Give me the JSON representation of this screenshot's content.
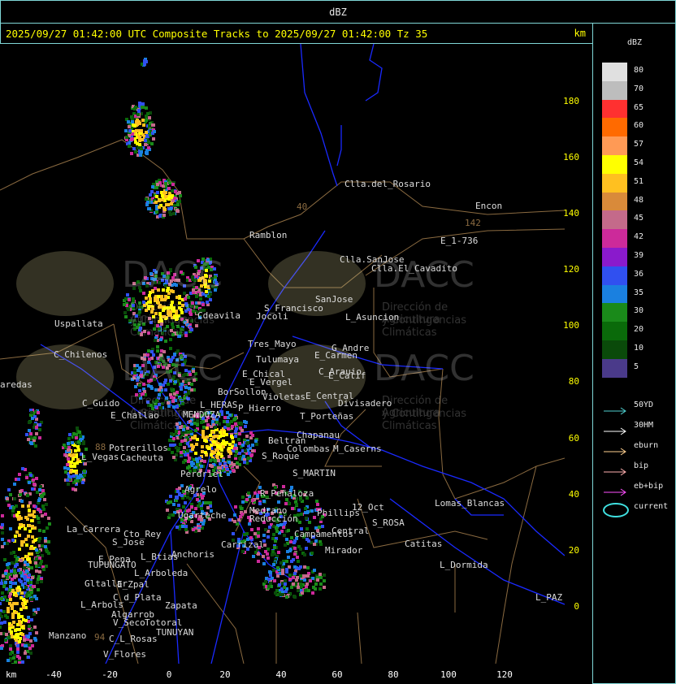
{
  "header": {
    "title": "dBZ"
  },
  "title_bar": {
    "text": "2025/09/27 01:42:00 UTC Composite Tracks to 2025/09/27 01:42:00 Tz 35",
    "unit": "km"
  },
  "axes": {
    "y_ticks": [
      "180",
      "160",
      "140",
      "120",
      "100",
      "80",
      "60",
      "40",
      "20",
      "0"
    ],
    "x_ticks": [
      "-40",
      "-20",
      "0",
      "20",
      "40",
      "60",
      "80",
      "100",
      "120"
    ],
    "x_unit": "km"
  },
  "legend": {
    "title": "dBZ",
    "scale": [
      {
        "label": "80",
        "color": "#e0e0e0"
      },
      {
        "label": "70",
        "color": "#bdbdbd"
      },
      {
        "label": "65",
        "color": "#ff3030"
      },
      {
        "label": "60",
        "color": "#ff6a00"
      },
      {
        "label": "57",
        "color": "#ff9a55"
      },
      {
        "label": "54",
        "color": "#ffff00"
      },
      {
        "label": "51",
        "color": "#ffc020"
      },
      {
        "label": "48",
        "color": "#d98a3a"
      },
      {
        "label": "45",
        "color": "#c46a8a"
      },
      {
        "label": "42",
        "color": "#cc2a9a"
      },
      {
        "label": "39",
        "color": "#8a1acc"
      },
      {
        "label": "36",
        "color": "#3050f0"
      },
      {
        "label": "35",
        "color": "#1a80e0"
      },
      {
        "label": "30",
        "color": "#1a8a1a"
      },
      {
        "label": "20",
        "color": "#0a6a0a"
      },
      {
        "label": "10",
        "color": "#0a4a0a"
      },
      {
        "label": "5",
        "color": "#4a3a8a"
      }
    ],
    "tracks": [
      {
        "label": "50YD",
        "color": "#4fd0d0"
      },
      {
        "label": "30HM",
        "color": "#ffffff"
      },
      {
        "label": "eburn",
        "color": "#ffd090"
      },
      {
        "label": "bip",
        "color": "#ffb0b0"
      },
      {
        "label": "eb+bip",
        "color": "#ff50ff"
      },
      {
        "label": "current",
        "color": "#40e0e0"
      }
    ]
  },
  "places": [
    {
      "name": "Clla.del_Rosario"
    },
    {
      "name": "Encon"
    },
    {
      "name": "142"
    },
    {
      "name": "E_1-736"
    },
    {
      "name": "Ramblon"
    },
    {
      "name": "Clla.SanJose"
    },
    {
      "name": "Clla.El_Cavadito"
    },
    {
      "name": "Uspallata"
    },
    {
      "name": "Cdeavila"
    },
    {
      "name": "S_Francisco"
    },
    {
      "name": "Jocoli"
    },
    {
      "name": "SanJose"
    },
    {
      "name": "L_Asuncion"
    },
    {
      "name": "C_Chilenos"
    },
    {
      "name": "Tres_Mayo"
    },
    {
      "name": "Tulumaya"
    },
    {
      "name": "G_Andre"
    },
    {
      "name": "E_Carmen"
    },
    {
      "name": "aredas"
    },
    {
      "name": "E_Chical"
    },
    {
      "name": "E_Vergel"
    },
    {
      "name": "C_Arauio"
    },
    {
      "name": "E_Calif"
    },
    {
      "name": "BorSollon"
    },
    {
      "name": "Violetas"
    },
    {
      "name": "E_Central"
    },
    {
      "name": "Divisadero"
    },
    {
      "name": "C_Guido"
    },
    {
      "name": "E_Challao"
    },
    {
      "name": "P_Hierro"
    },
    {
      "name": "T_Porteñas"
    },
    {
      "name": "Chapanau"
    },
    {
      "name": "Beltran"
    },
    {
      "name": "Potrerillos"
    },
    {
      "name": "L_Vegas"
    },
    {
      "name": "Cacheuta"
    },
    {
      "name": "Colombas"
    },
    {
      "name": "M_Caserns"
    },
    {
      "name": "S_Roque"
    },
    {
      "name": "Perdriel"
    },
    {
      "name": "S_MARTIN"
    },
    {
      "name": "Agrelo"
    },
    {
      "name": "R_Peñaloza"
    },
    {
      "name": "Ugarteche"
    },
    {
      "name": "Medrano"
    },
    {
      "name": "Reducción"
    },
    {
      "name": "Phillips"
    },
    {
      "name": "12_Oct"
    },
    {
      "name": "S_ROSA"
    },
    {
      "name": "Lomas_Blancas"
    },
    {
      "name": "La_Carrera"
    },
    {
      "name": "Cto_Rey"
    },
    {
      "name": "S_Jose"
    },
    {
      "name": "Anchoris"
    },
    {
      "name": "Carrizal"
    },
    {
      "name": "Campamentos"
    },
    {
      "name": "Central"
    },
    {
      "name": "Catitas"
    },
    {
      "name": "E_Pena"
    },
    {
      "name": "TUPUNGATO"
    },
    {
      "name": "L_Btias"
    },
    {
      "name": "L_Arboleda"
    },
    {
      "name": "Mirador"
    },
    {
      "name": "L_Dormida"
    },
    {
      "name": "Gltallar"
    },
    {
      "name": "E_Zpal"
    },
    {
      "name": "C_d_Plata"
    },
    {
      "name": "L_Arbols"
    },
    {
      "name": "Zapata"
    },
    {
      "name": "L_PAZ"
    },
    {
      "name": "Algarrob"
    },
    {
      "name": "V_Seco"
    },
    {
      "name": "Totoral"
    },
    {
      "name": "TUNUYAN"
    },
    {
      "name": "Manzano"
    },
    {
      "name": "94"
    },
    {
      "name": "C_L_Rosas"
    },
    {
      "name": "V_Flores"
    },
    {
      "name": "88"
    },
    {
      "name": "40"
    },
    {
      "name": "MENDOZA"
    },
    {
      "name": "L_HERAS"
    }
  ],
  "watermark": {
    "brand": "DACC",
    "line1": "Dirección de Agricultura",
    "line2": "y Contingencias Climáticas"
  }
}
